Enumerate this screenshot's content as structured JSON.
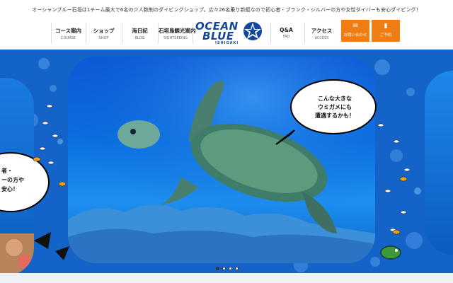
{
  "header": {
    "tagline": "オーシャンブルー石垣は1チーム最大で6名の少人数制のダイビングショップ。広々26名乗り新艇なので初心者・ブランク・シルバーの方や女性ダイバーも安心ダイビング！",
    "logo": {
      "line1": "OCEAN",
      "line2": "BLUE",
      "line3": "ISHIGAKI"
    }
  },
  "nav": {
    "items": [
      {
        "jp": "コース案内",
        "en": "COURSE"
      },
      {
        "jp": "ショップ",
        "en": "SHOP"
      },
      {
        "jp": "海日記",
        "en": "BLOG"
      },
      {
        "jp": "石垣島観光案内",
        "en": "SIGHTSEEING"
      },
      {
        "jp": "Q&A",
        "en": "FAQ"
      },
      {
        "jp": "アクセス",
        "en": "ACCESS"
      }
    ],
    "contact": {
      "label": "お問い合わせ",
      "icon": "mail-icon"
    },
    "reserve": {
      "label": "ご予約",
      "icon": "phone-icon"
    }
  },
  "hero": {
    "bubble": {
      "lines": [
        "こんな大きな",
        "ウミガメにも",
        "遭遇するかも！"
      ]
    },
    "bubble_left": {
      "lines": [
        "者・",
        "ーの方や",
        "安心！"
      ]
    },
    "slides": {
      "count": 4,
      "active": 1
    }
  },
  "colors": {
    "brand": "#12489b",
    "accent": "#ef7d13",
    "sea": "#1463c8"
  }
}
